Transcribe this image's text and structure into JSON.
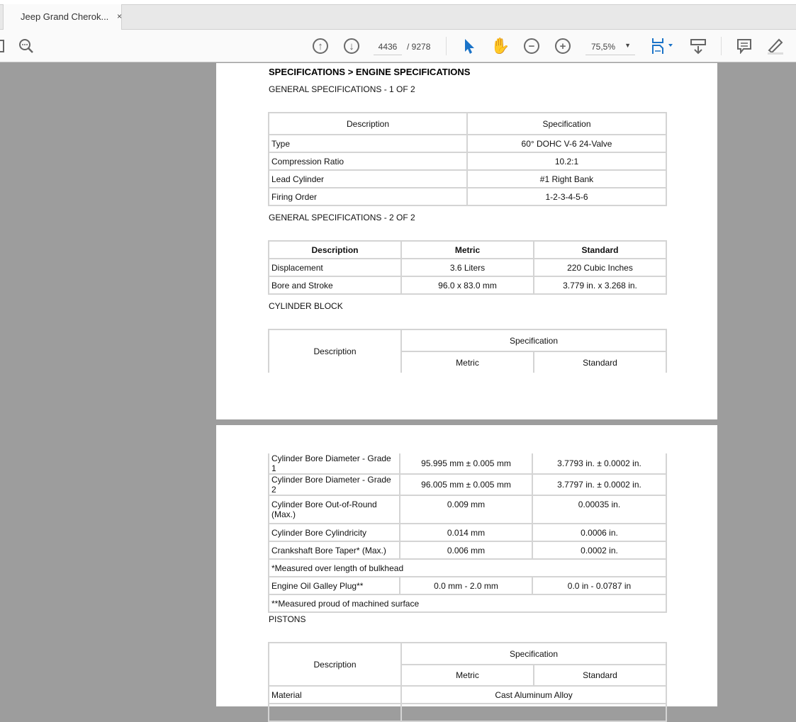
{
  "tab": {
    "title": "Jeep Grand Cherok...",
    "close": "×"
  },
  "toolbar": {
    "page_current": "4436",
    "page_total": "/ 9278",
    "zoom": "75,5%"
  },
  "page1": {
    "heading": "SPECIFICATIONS > ENGINE SPECIFICATIONS",
    "general1": {
      "title": "GENERAL SPECIFICATIONS - 1 OF 2",
      "headers": [
        "Description",
        "Specification"
      ],
      "rows": [
        [
          "Type",
          "60° DOHC V-6 24-Valve"
        ],
        [
          "Compression Ratio",
          "10.2:1"
        ],
        [
          "Lead Cylinder",
          "#1 Right Bank"
        ],
        [
          "Firing Order",
          "1-2-3-4-5-6"
        ]
      ]
    },
    "general2": {
      "title": "GENERAL SPECIFICATIONS - 2 OF 2",
      "headers": [
        "Description",
        "Metric",
        "Standard"
      ],
      "rows": [
        [
          "Displacement",
          "3.6 Liters",
          "220 Cubic Inches"
        ],
        [
          "Bore and Stroke",
          "96.0 x 83.0 mm",
          "3.779 in. x 3.268 in."
        ]
      ]
    },
    "block": {
      "title": "CYLINDER BLOCK",
      "headers": {
        "description": "Description",
        "specification": "Specification",
        "metric": "Metric",
        "standard": "Standard"
      }
    }
  },
  "page2": {
    "block_rows": [
      [
        "Cylinder Bore Diameter - Grade 1",
        "95.995 mm ± 0.005 mm",
        "3.7793 in. ± 0.0002 in."
      ],
      [
        "Cylinder Bore Diameter - Grade 2",
        "96.005 mm ± 0.005 mm",
        "3.7797 in. ± 0.0002 in."
      ],
      [
        "Cylinder Bore Out-of-Round (Max.)",
        "0.009 mm",
        "0.00035 in."
      ],
      [
        "Cylinder Bore Cylindricity",
        "0.014 mm",
        "0.0006 in."
      ],
      [
        "Crankshaft Bore Taper* (Max.)",
        "0.006 mm",
        "0.0002 in."
      ]
    ],
    "note1": "*Measured over length of bulkhead",
    "galley": [
      "Engine Oil Galley Plug**",
      "0.0 mm - 2.0 mm",
      "0.0 in - 0.0787 in"
    ],
    "note2": "**Measured proud of machined surface",
    "pistons": {
      "title": "PISTONS",
      "headers": {
        "description": "Description",
        "specification": "Specification",
        "metric": "Metric",
        "standard": "Standard"
      },
      "rows": [
        [
          "Material",
          "Cast Aluminum Alloy"
        ]
      ]
    }
  }
}
